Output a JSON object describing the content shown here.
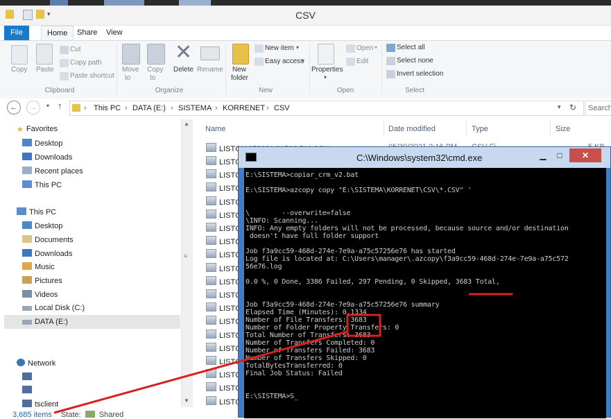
{
  "window": {
    "title": "CSV"
  },
  "ribbon_tabs": [
    "File",
    "Home",
    "Share",
    "View"
  ],
  "ribbon": {
    "clipboard": {
      "copy": "Copy",
      "paste": "Paste",
      "cut": "Cut",
      "copy_path": "Copy path",
      "paste_shortcut": "Paste shortcut",
      "label": "Clipboard"
    },
    "organize": {
      "move_to": "Move",
      "move_to2": "to",
      "copy_to": "Copy",
      "copy_to2": "to",
      "delete": "Delete",
      "rename": "Rename",
      "label": "Organize"
    },
    "new": {
      "new_folder": "New",
      "new_folder2": "folder",
      "new_item": "New item",
      "easy_access": "Easy access",
      "label": "New"
    },
    "open": {
      "properties": "Properties",
      "open": "Open",
      "edit": "Edit",
      "label": "Open"
    },
    "select": {
      "select_all": "Select all",
      "select_none": "Select none",
      "invert": "Invert selection",
      "label": "Select"
    }
  },
  "address": {
    "breadcrumb": [
      "This PC",
      "DATA (E:)",
      "SISTEMA",
      "KORRENET",
      "CSV"
    ],
    "search_placeholder": "Search"
  },
  "nav": {
    "favorites": "Favorites",
    "fav_items": [
      "Desktop",
      "Downloads",
      "Recent places",
      "This PC"
    ],
    "this_pc": "This PC",
    "pc_items": [
      "Desktop",
      "Documents",
      "Downloads",
      "Music",
      "Pictures",
      "Videos",
      "Local Disk (C:)",
      "DATA (E:)"
    ],
    "network": "Network",
    "net_items": [
      "",
      "",
      "tsclient"
    ]
  },
  "columns": {
    "name": "Name",
    "date": "Date modified",
    "type": "Type",
    "size": "Size"
  },
  "file_row_first": {
    "name": "LISTCH 053021 21516 PM.CSV",
    "date": "05/30/2021 2:16 PM",
    "type": "CSV Fi",
    "size": "5 KB"
  },
  "file_rows": [
    "LISTCI",
    "LISTCI",
    "LISTCI",
    "LISTCI",
    "LISTCI",
    "LISTCI",
    "LISTCI",
    "LISTCI",
    "LISTCI",
    "LISTCI",
    "LISTCI",
    "LISTCI",
    "LISTCI",
    "LISTCI",
    "LISTCI",
    "LISTCI",
    "LISTCI",
    "LISTCI",
    "LISTCI"
  ],
  "status": {
    "count": "3,685 items",
    "state_label": "State:",
    "state_value": "Shared"
  },
  "cmd": {
    "title": "C:\\Windows\\system32\\cmd.exe",
    "lines": [
      "E:\\SISTEMA>copiar_crm_v2.bat",
      "",
      "E:\\SISTEMA>azcopy copy \"E:\\SISTEMA\\KORRENET\\CSV\\*.CSV\" '",
      "",
      "",
      "\\        --overwrite=false",
      "\\INFO: Scanning...",
      "INFO: Any empty folders will not be processed, because source and/or destination",
      " doesn't have full folder support",
      "",
      "Job f3a9cc59-468d-274e-7e9a-a75c57256e76 has started",
      "Log file is located at: C:\\Users\\manager\\.azcopy\\f3a9cc59-468d-274e-7e9a-a75c572",
      "56e76.log",
      "",
      "0.0 %, 0 Done, 3386 Failed, 297 Pending, 0 Skipped, 3683 Total,",
      "",
      "",
      "Job f3a9cc59-468d-274e-7e9a-a75c57256e76 summary",
      "Elapsed Time (Minutes): 0.1334",
      "Number of File Transfers: 3683",
      "Number of Folder Property Transfers: 0",
      "Total Number of Transfers: 3683",
      "Number of Transfers Completed: 0",
      "Number of Transfers Failed: 3683",
      "Number of Transfers Skipped: 0",
      "TotalBytesTransferred: 0",
      "Final Job Status: Failed",
      "",
      "",
      "E:\\SISTEMA>S_"
    ]
  },
  "colors": {
    "accent": "#1979ca",
    "annotation": "#d9201f",
    "cmd_border": "#3f7dc9"
  }
}
